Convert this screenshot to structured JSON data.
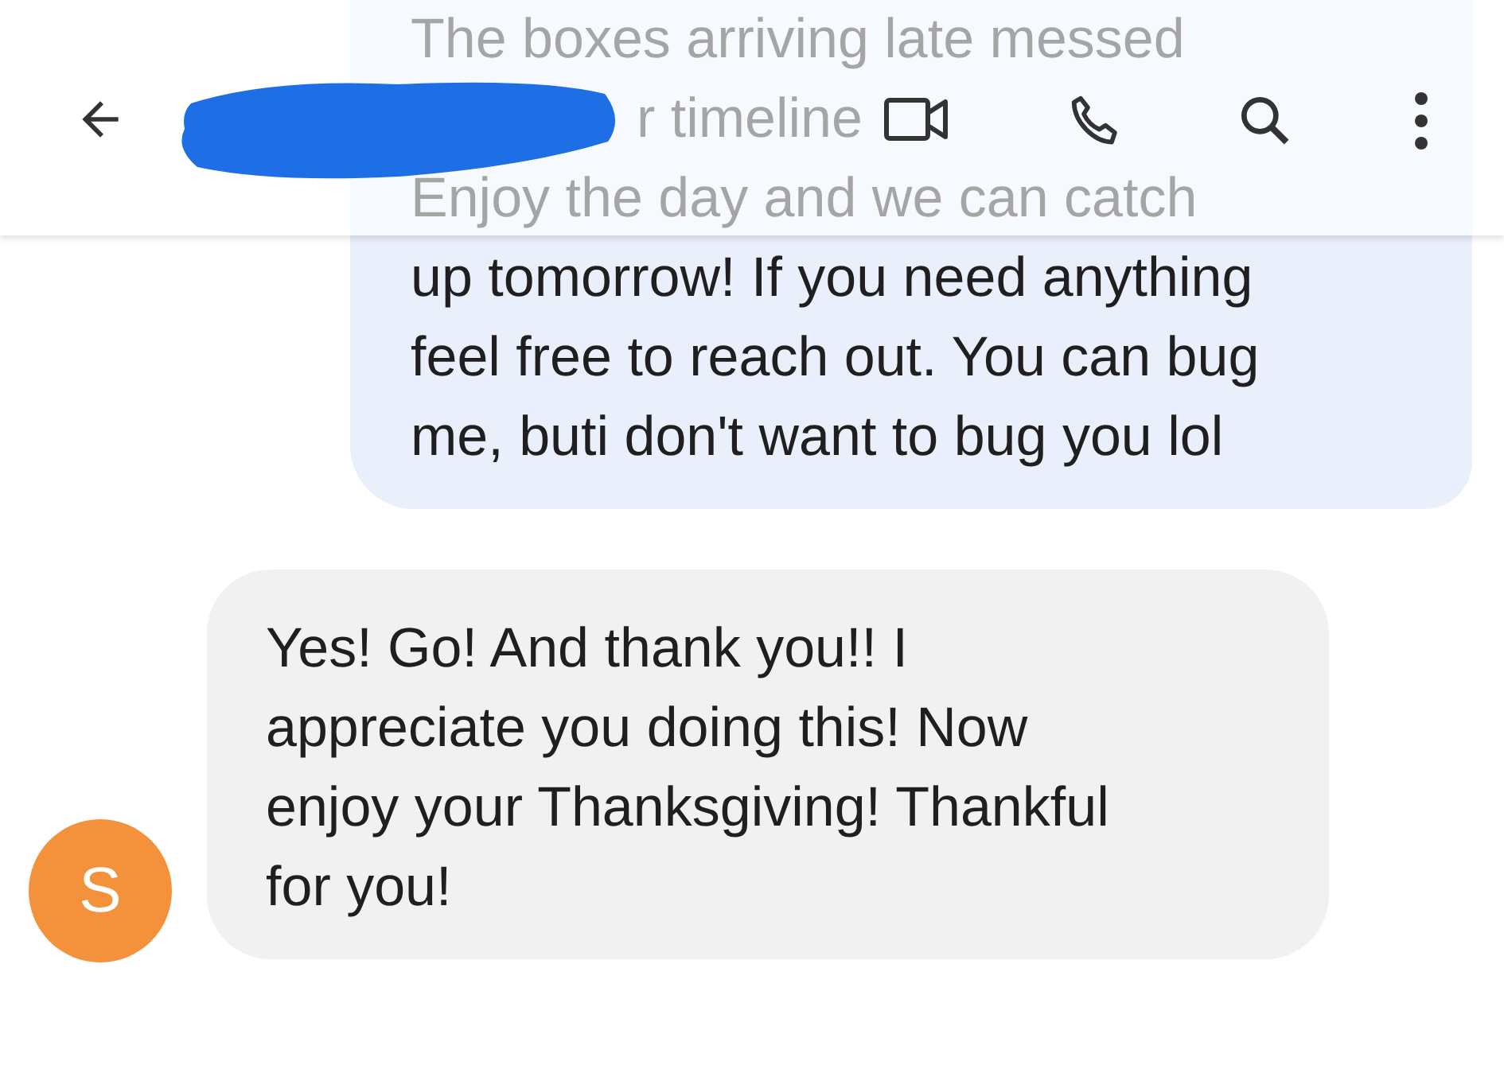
{
  "header": {
    "faded_lines": [
      "The boxes arriving late messed",
      "r timeline",
      "Enjoy the day and we can catch"
    ]
  },
  "messages": [
    {
      "kind": "sent",
      "text": "up tomorrow! If you need anything\nfeel free to reach out. You can bug\nme, buti don't want to bug you lol"
    },
    {
      "kind": "received",
      "avatar": "S",
      "color": "#f4913b",
      "text": "Yes! Go! And thank you!! I\nappreciate you doing this! Now\nenjoy your Thanksgiving! Thankful\nfor you!"
    }
  ]
}
